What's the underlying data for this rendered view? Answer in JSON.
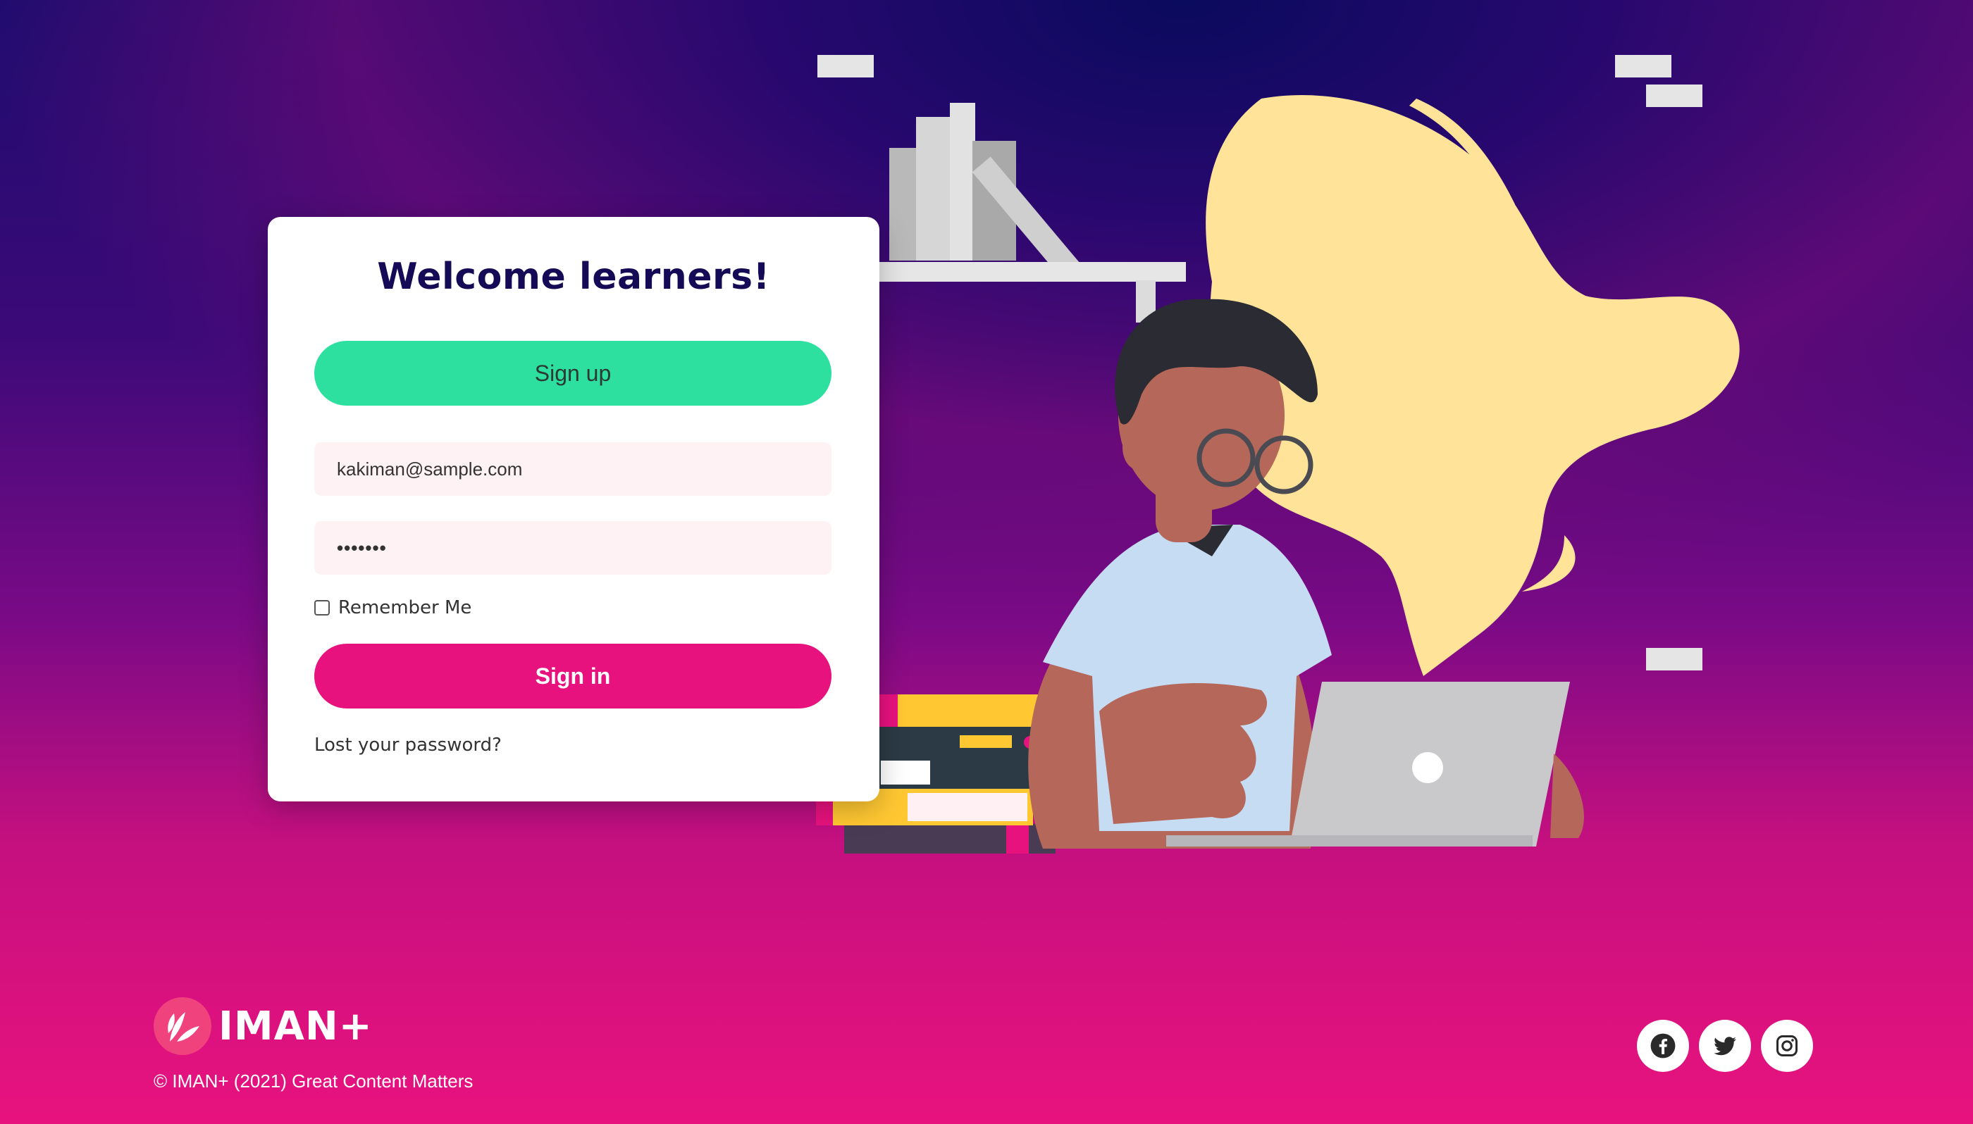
{
  "login": {
    "title": "Welcome learners!",
    "signup_label": "Sign up",
    "email_value": "kakiman@sample.com",
    "password_value": "•••••••",
    "remember_label": "Remember Me",
    "remember_checked": false,
    "signin_label": "Sign in",
    "lost_password_label": "Lost your password?"
  },
  "footer": {
    "logo_text": "IMAN+",
    "copyright": "© IMAN+ (2021) Great Content Matters",
    "social": [
      {
        "icon": "facebook-icon"
      },
      {
        "icon": "twitter-icon"
      },
      {
        "icon": "instagram-icon"
      }
    ]
  },
  "colors": {
    "signup": "#2ee09f",
    "signin": "#e8127e",
    "title": "#140a55",
    "field_bg": "#fff2f4"
  }
}
